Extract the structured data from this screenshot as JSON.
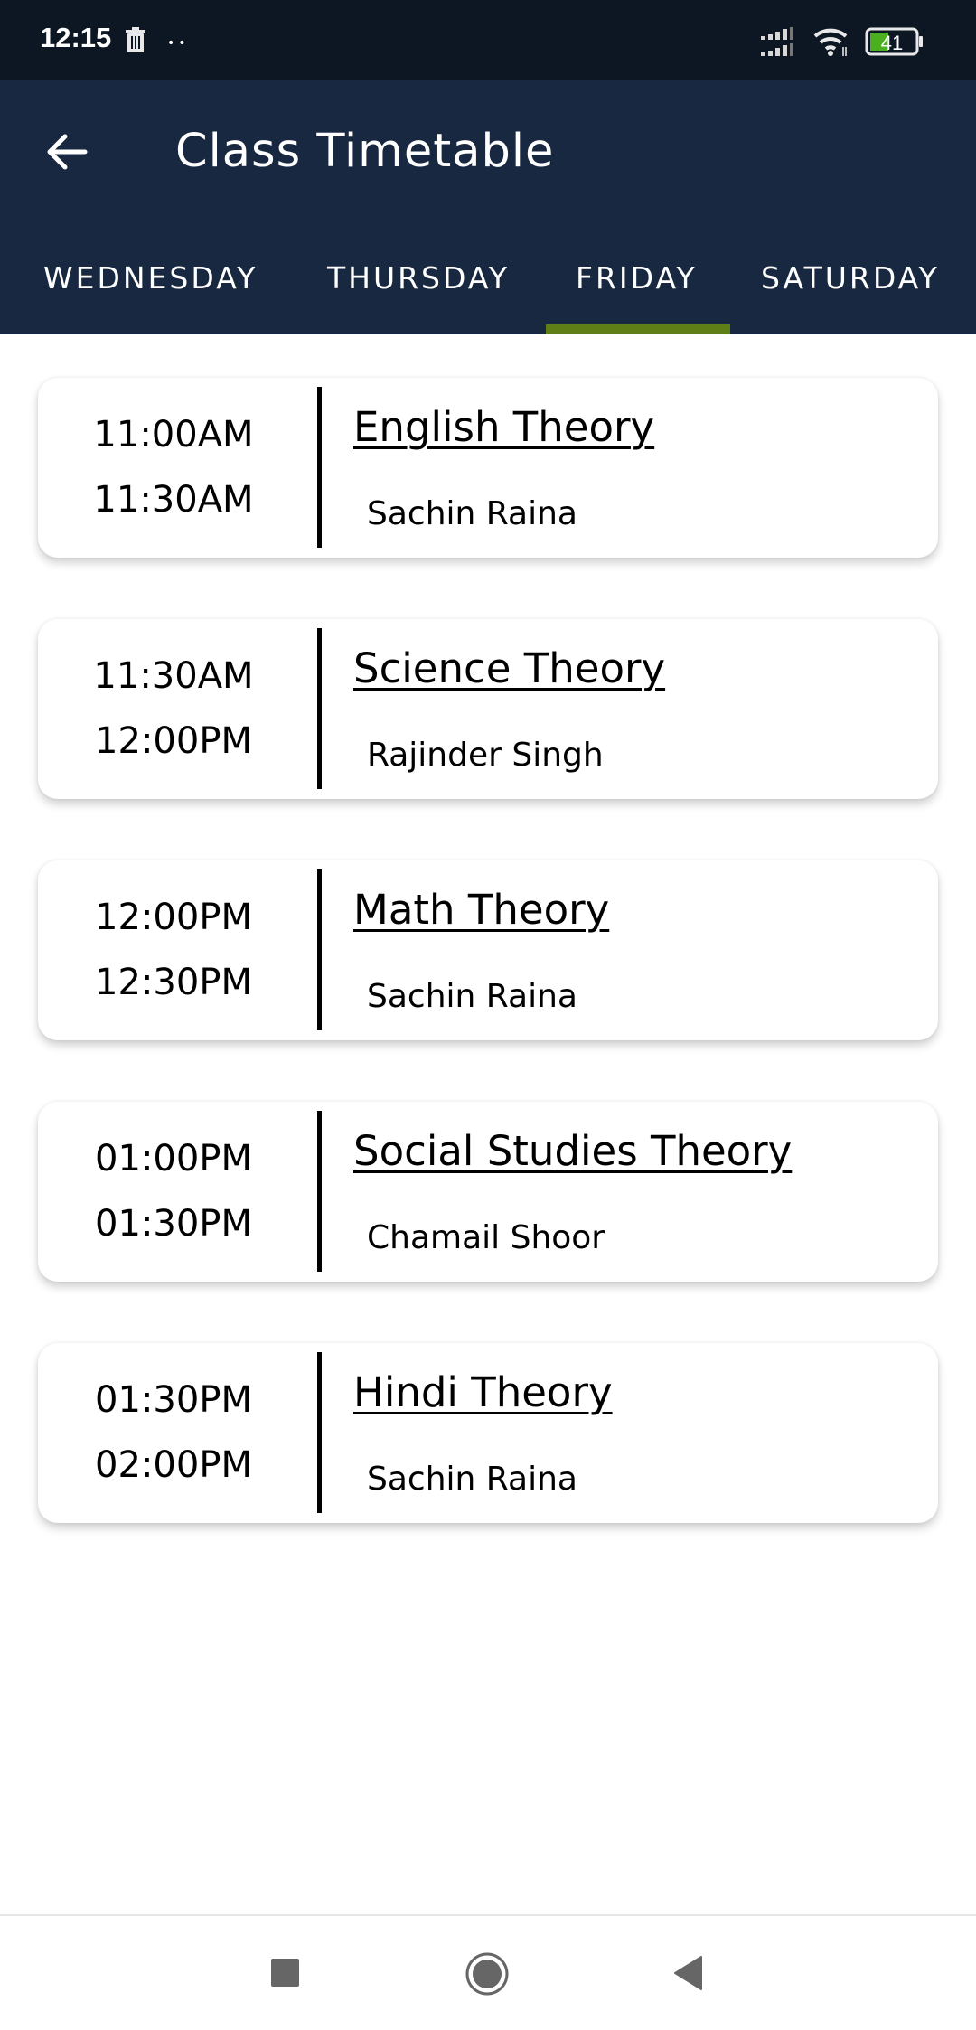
{
  "status_bar": {
    "time": "12:15",
    "notification_icons": [
      "trash-icon",
      "more-dots-icon"
    ],
    "dots": "••",
    "system_icons": [
      "signal-icon",
      "wifi-icon",
      "battery-icon"
    ],
    "battery_level": "41",
    "battery_color": "#4caf20"
  },
  "app_bar": {
    "back_icon": "arrow-left-icon",
    "title": "Class Timetable",
    "background_color": "#172840"
  },
  "tabs": {
    "items": [
      {
        "label": "WEDNESDAY",
        "selected": false
      },
      {
        "label": "THURSDAY",
        "selected": false
      },
      {
        "label": "FRIDAY",
        "selected": true
      },
      {
        "label": "SATURDAY",
        "selected": false
      }
    ],
    "indicator_color": "#5f7f16"
  },
  "classes": [
    {
      "start": "11:00AM",
      "end": "11:30AM",
      "subject": "English Theory",
      "teacher": "Sachin Raina"
    },
    {
      "start": "11:30AM",
      "end": "12:00PM",
      "subject": "Science Theory",
      "teacher": "Rajinder Singh"
    },
    {
      "start": "12:00PM",
      "end": "12:30PM",
      "subject": "Math Theory",
      "teacher": "Sachin Raina"
    },
    {
      "start": "01:00PM",
      "end": "01:30PM",
      "subject": "Social Studies Theory",
      "teacher": "Chamail Shoor"
    },
    {
      "start": "01:30PM",
      "end": "02:00PM",
      "subject": "Hindi Theory",
      "teacher": "Sachin Raina"
    }
  ],
  "nav_bar": {
    "buttons": [
      "recent-apps-icon",
      "home-icon",
      "back-icon"
    ]
  }
}
